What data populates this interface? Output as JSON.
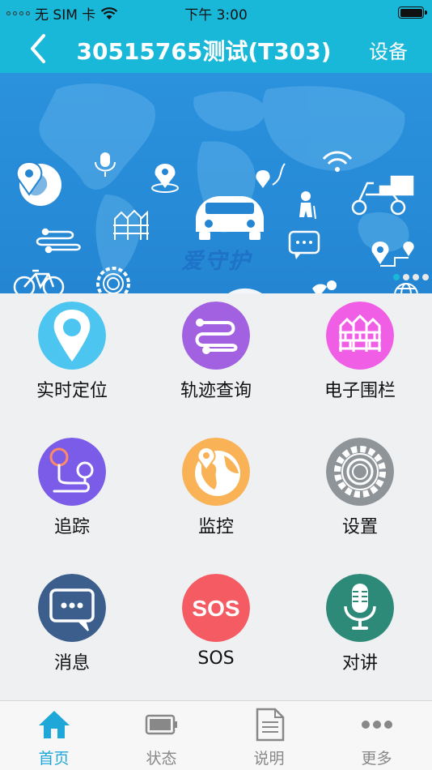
{
  "status_bar": {
    "carrier": "无 SIM 卡",
    "time": "下午 3:00"
  },
  "nav": {
    "title": "30515765测试(T303)",
    "right_label": "设备"
  },
  "banner": {
    "cloud_label": "爱守护",
    "page_count": 4,
    "active_page": 0
  },
  "grid": [
    {
      "label": "实时定位",
      "icon": "location-pin-icon",
      "color": "#4cc6f0"
    },
    {
      "label": "轨迹查询",
      "icon": "track-route-icon",
      "color": "#a261e0"
    },
    {
      "label": "电子围栏",
      "icon": "fence-icon",
      "color": "#f05ee6"
    },
    {
      "label": "追踪",
      "icon": "tracking-icon",
      "color": "#7a5ce8"
    },
    {
      "label": "监控",
      "icon": "globe-monitor-icon",
      "color": "#f9b255"
    },
    {
      "label": "设置",
      "icon": "gear-icon",
      "color": "#8f9499"
    },
    {
      "label": "消息",
      "icon": "chat-bubble-icon",
      "color": "#3b5e8c"
    },
    {
      "label": "SOS",
      "icon": "sos-icon",
      "color": "#f45b63"
    },
    {
      "label": "对讲",
      "icon": "microphone-icon",
      "color": "#2e8a78"
    }
  ],
  "tabs": [
    {
      "label": "首页",
      "icon": "home-icon",
      "active": true
    },
    {
      "label": "状态",
      "icon": "battery-icon",
      "active": false
    },
    {
      "label": "说明",
      "icon": "document-icon",
      "active": false
    },
    {
      "label": "更多",
      "icon": "more-dots-icon",
      "active": false
    }
  ],
  "colors": {
    "accent": "#19b8d9",
    "tab_active": "#1ea7d8"
  }
}
